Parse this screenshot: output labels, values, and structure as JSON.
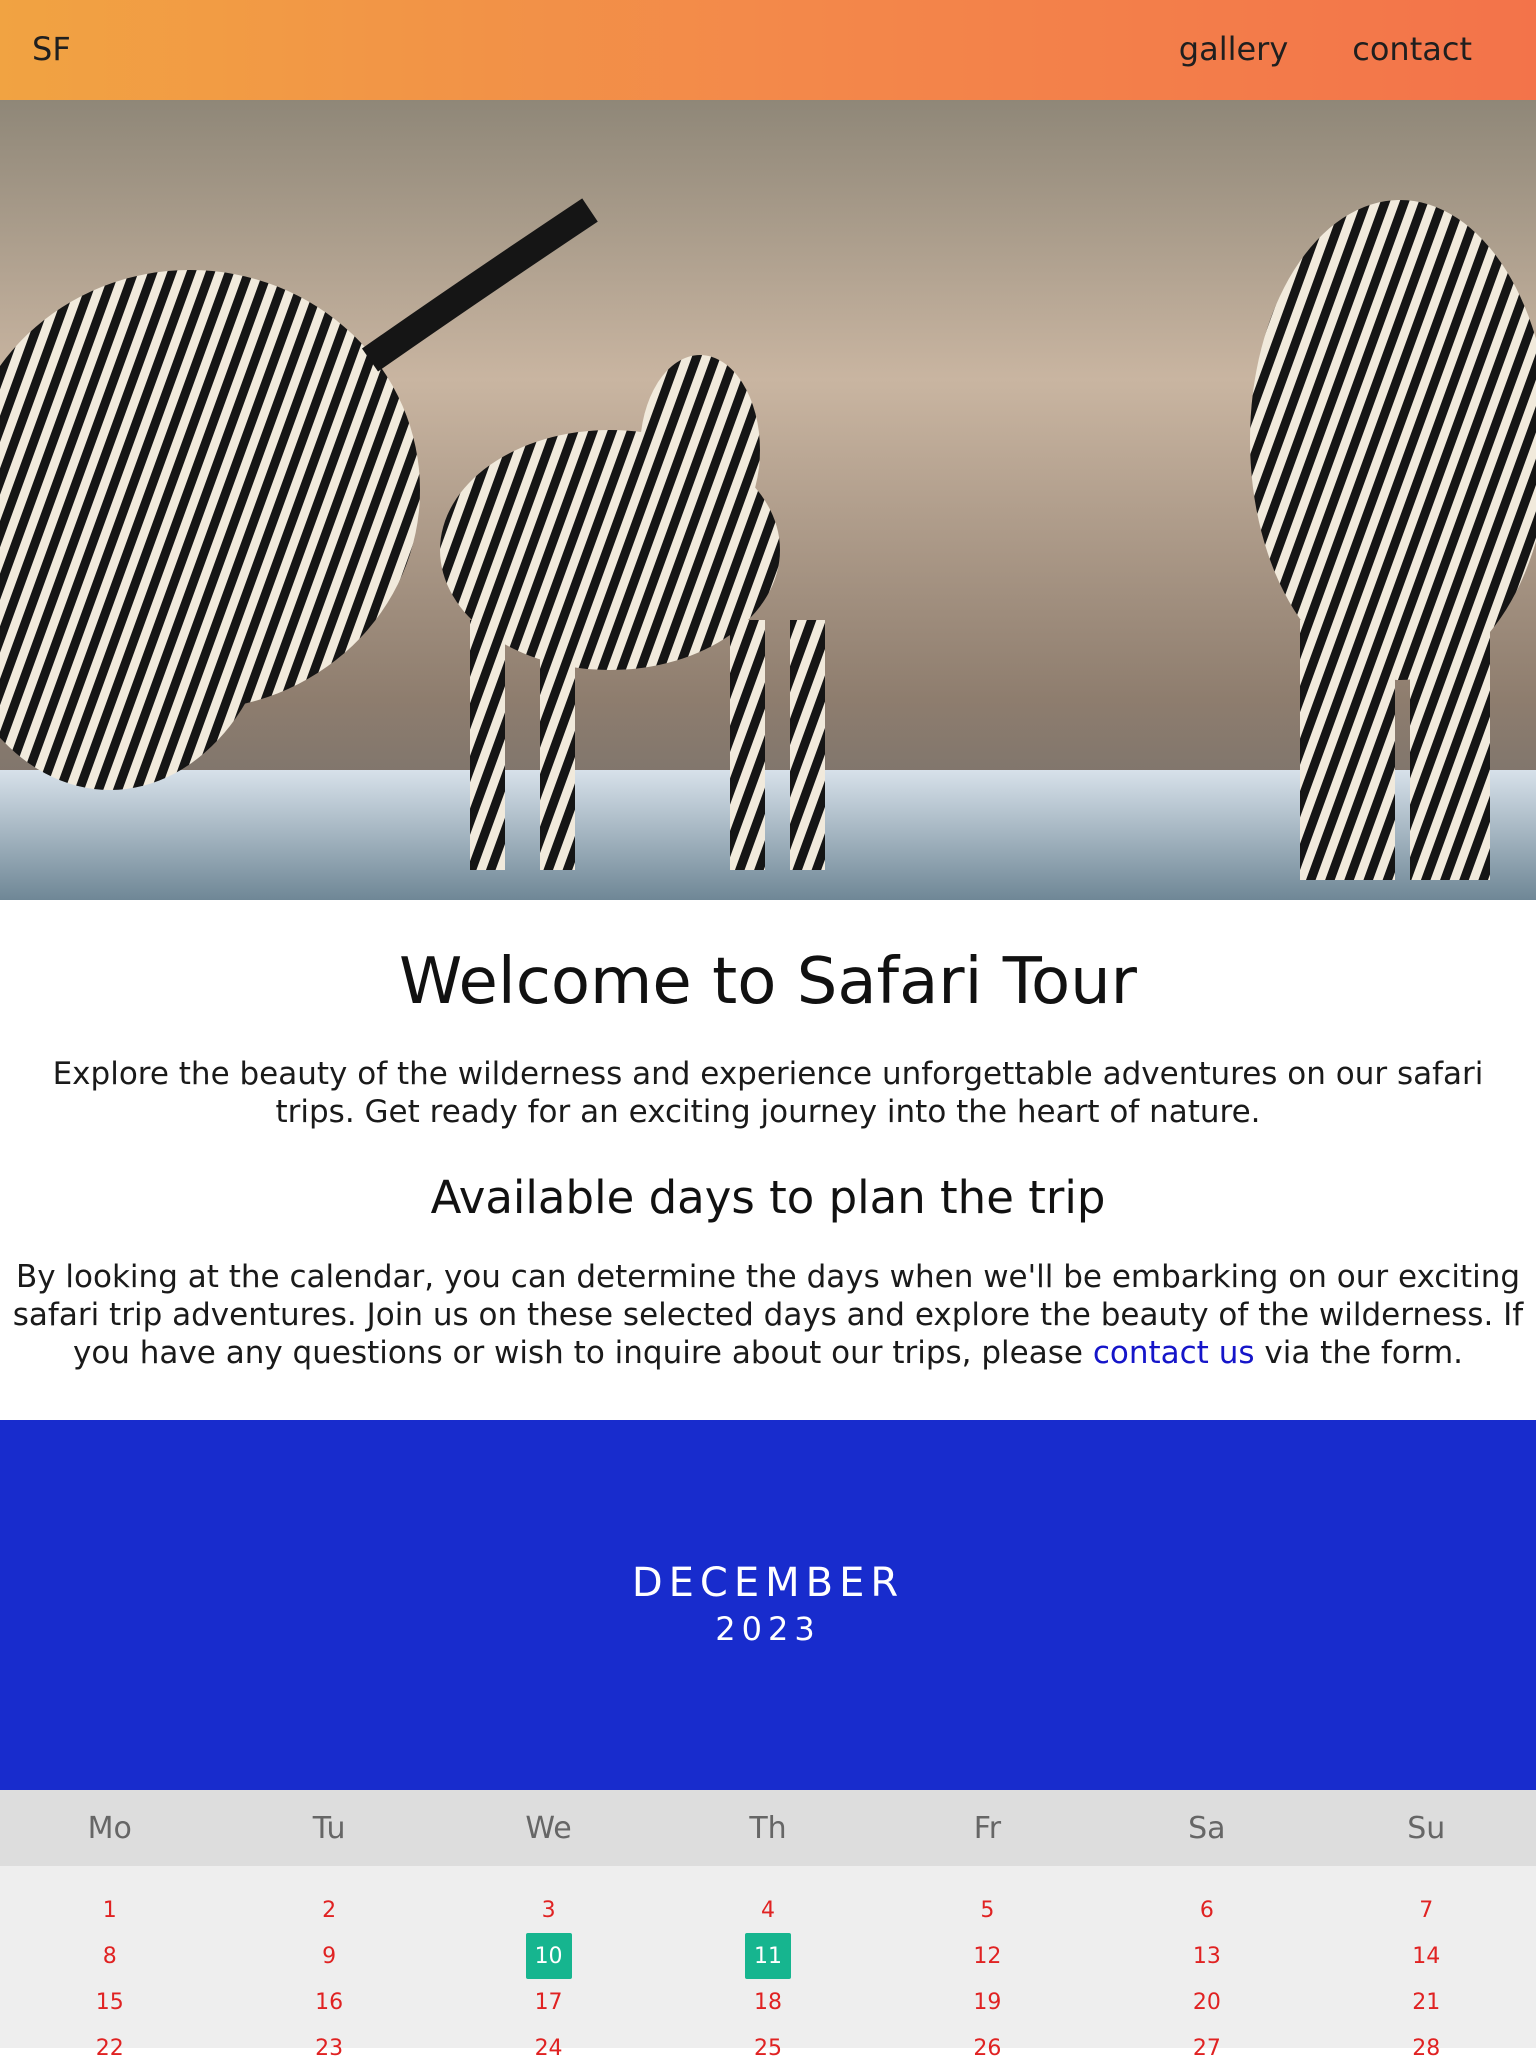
{
  "header": {
    "brand": "SF",
    "nav": [
      {
        "label": "gallery"
      },
      {
        "label": "contact"
      }
    ]
  },
  "hero": {
    "alt": "Zebras drinking at a waterhole"
  },
  "content": {
    "title": "Welcome to Safari Tour",
    "intro": "Explore the beauty of the wilderness and experience unforgettable adventures on our safari trips. Get ready for an exciting journey into the heart of nature.",
    "subtitle": "Available days to plan the trip",
    "desc_before": "By looking at the calendar, you can determine the days when we'll be embarking on our exciting safari trip adventures. Join us on these selected days and explore the beauty of the wilderness. If you have any questions or wish to inquire about our trips, please ",
    "desc_link": "contact us",
    "desc_after": " via the form."
  },
  "calendar": {
    "month": "DECEMBER",
    "year": "2023",
    "weekdays": [
      "Mo",
      "Tu",
      "We",
      "Th",
      "Fr",
      "Sa",
      "Su"
    ],
    "rows": [
      [
        "1",
        "2",
        "3",
        "4",
        "5",
        "6",
        "7"
      ],
      [
        "8",
        "9",
        "10",
        "11",
        "12",
        "13",
        "14"
      ],
      [
        "15",
        "16",
        "17",
        "18",
        "19",
        "20",
        "21"
      ],
      [
        "22",
        "23",
        "24",
        "25",
        "26",
        "27",
        "28"
      ]
    ],
    "highlighted": [
      "10",
      "11"
    ]
  },
  "colors": {
    "header_gradient_start": "#f1a342",
    "header_gradient_end": "#f3734a",
    "calendar_header": "#182ccd",
    "active_day": "#16b58f",
    "day_text": "#e02222",
    "link": "#1515c9"
  }
}
